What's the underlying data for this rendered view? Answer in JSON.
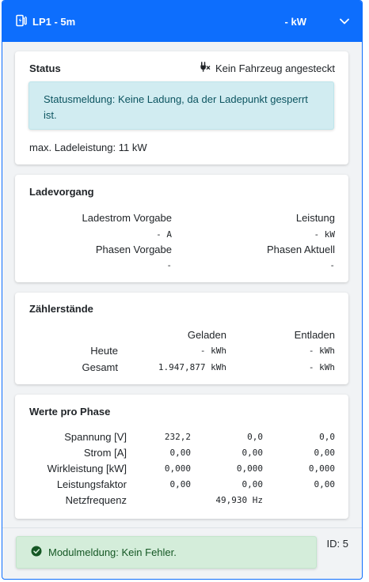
{
  "header": {
    "charger_icon": "ev-charger-icon",
    "title": "LP1 - 5m",
    "power": "- kW",
    "toggle_icon": "chevron-down-icon"
  },
  "status": {
    "title": "Status",
    "plug_icon": "plug-icon",
    "vehicle_state": "Kein Fahrzeug angesteckt",
    "message": "Statusmeldung: Keine Ladung, da der Ladepunkt gesperrt ist.",
    "max_power": "max. Ladeleistung: 11 kW"
  },
  "charging": {
    "title": "Ladevorgang",
    "current_setpoint_label": "Ladestrom Vorgabe",
    "current_setpoint_value": "- A",
    "power_label": "Leistung",
    "power_value": "- kW",
    "phases_setpoint_label": "Phasen Vorgabe",
    "phases_setpoint_value": "-",
    "phases_actual_label": "Phasen Aktuell",
    "phases_actual_value": "-"
  },
  "meters": {
    "title": "Zählerstände",
    "col_charged": "Geladen",
    "col_discharged": "Entladen",
    "rows": [
      {
        "label": "Heute",
        "charged": "- kWh",
        "discharged": "- kWh"
      },
      {
        "label": "Gesamt",
        "charged": "1.947,877 kWh",
        "discharged": "- kWh"
      }
    ]
  },
  "phases": {
    "title": "Werte pro Phase",
    "rows": [
      {
        "label": "Spannung [V]",
        "l1": "232,2",
        "l2": "0,0",
        "l3": "0,0"
      },
      {
        "label": "Strom [A]",
        "l1": "0,00",
        "l2": "0,00",
        "l3": "0,00"
      },
      {
        "label": "Wirkleistung [kW]",
        "l1": "0,000",
        "l2": "0,000",
        "l3": "0,000"
      },
      {
        "label": "Leistungsfaktor",
        "l1": "0,00",
        "l2": "0,00",
        "l3": "0,00"
      }
    ],
    "frequency_label": "Netzfrequenz",
    "frequency_value": "49,930 Hz"
  },
  "footer": {
    "check_icon": "check-circle-icon",
    "module_message": "Modulmeldung: Kein Fehler.",
    "id": "ID: 5"
  },
  "colors": {
    "primary": "#0d6efd",
    "info_bg": "#d1ecf1",
    "success_bg": "#d4edda",
    "success_text": "#155724"
  }
}
